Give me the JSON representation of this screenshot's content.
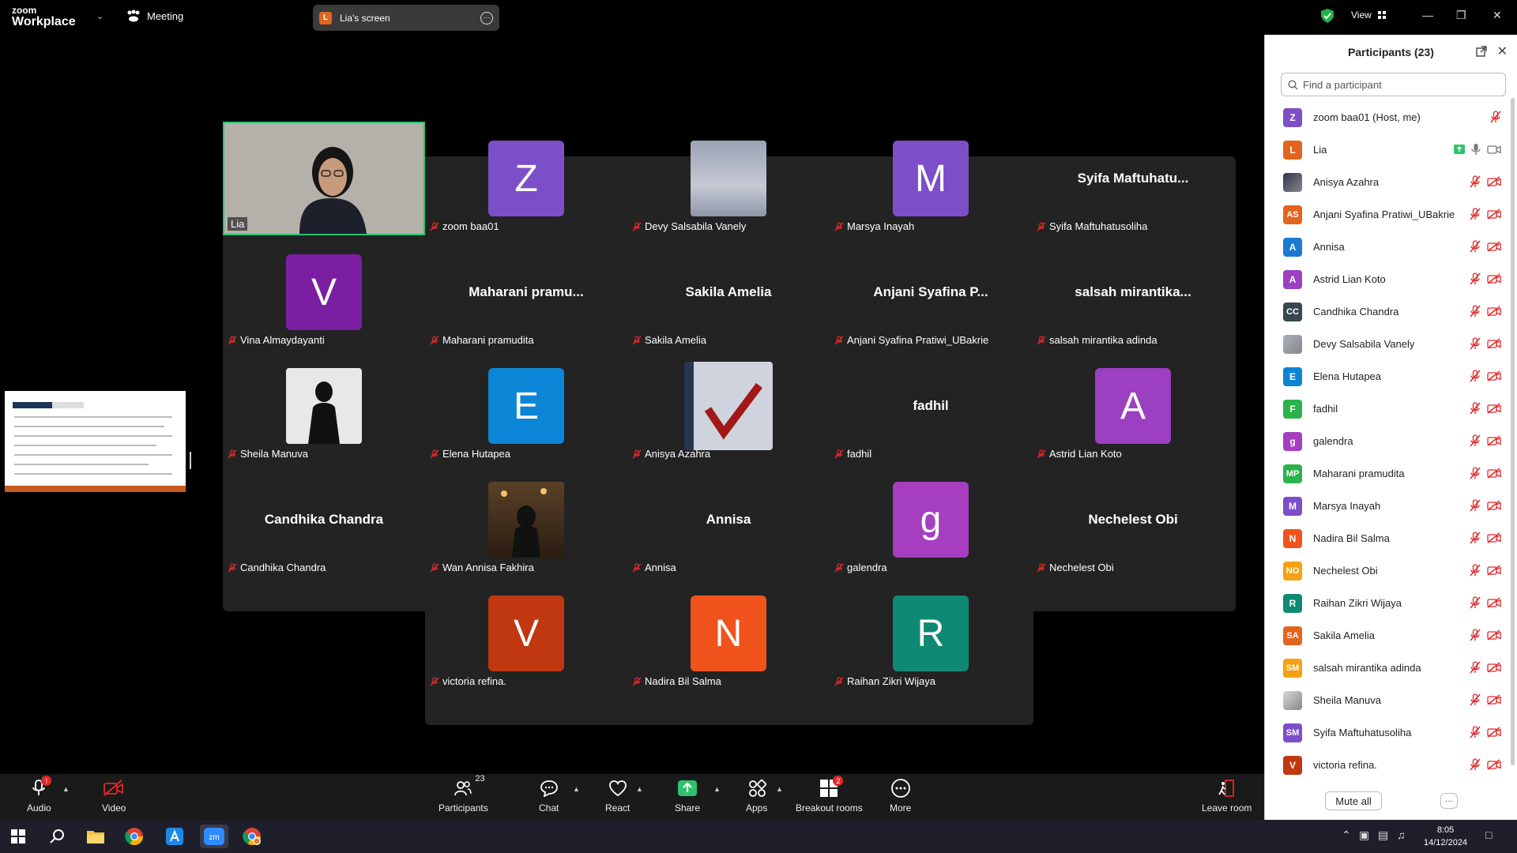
{
  "topbar": {
    "logo_line1": "zoom",
    "logo_line2": "Workplace",
    "meeting_label": "Meeting",
    "screen_share_avatar": "L",
    "screen_share_label": "Lia's screen",
    "view_label": "View"
  },
  "tiles": [
    {
      "name": "Lia",
      "type": "active"
    },
    {
      "name": "zoom baa01",
      "type": "avatar",
      "letter": "Z",
      "color": "#7c4fc8"
    },
    {
      "name": "Devy Salsabila Vanely",
      "type": "photo-sky"
    },
    {
      "name": "Marsya Inayah",
      "type": "avatar",
      "letter": "M",
      "color": "#7c4fc8"
    },
    {
      "name": "Syifa Maftuhatusoliha",
      "type": "text",
      "display": "Syifa  Maftuhatu..."
    },
    {
      "name": "Vina Almaydayanti",
      "type": "avatar",
      "letter": "V",
      "color": "#7b1fa2"
    },
    {
      "name": "Maharani pramudita",
      "type": "text",
      "display": "Maharani  pramu..."
    },
    {
      "name": "Sakila Amelia",
      "type": "text",
      "display": "Sakila Amelia"
    },
    {
      "name": "Anjani Syafina Pratiwi_UBakrie",
      "type": "text",
      "display": "Anjani  Syafina  P..."
    },
    {
      "name": "salsah mirantika adinda",
      "type": "text",
      "display": "salsah  mirantika..."
    },
    {
      "name": "Sheila Manuva",
      "type": "photo-person"
    },
    {
      "name": "Elena Hutapea",
      "type": "avatar",
      "letter": "E",
      "color": "#0b86d6"
    },
    {
      "name": "Anisya Azahra",
      "type": "photo-dark"
    },
    {
      "name": "fadhil",
      "type": "text",
      "display": "fadhil"
    },
    {
      "name": "Astrid Lian Koto",
      "type": "avatar",
      "letter": "A",
      "color": "#9c3fc0"
    },
    {
      "name": "Candhika Chandra",
      "type": "text",
      "display": "Candhika Chandra"
    },
    {
      "name": "Wan Annisa Fakhira",
      "type": "photo-cafe"
    },
    {
      "name": "Annisa",
      "type": "text",
      "display": "Annisa"
    },
    {
      "name": "galendra",
      "type": "avatar",
      "letter": "g",
      "color": "#a63ec0"
    },
    {
      "name": "Nechelest Obi",
      "type": "text",
      "display": "Nechelest Obi"
    },
    {
      "name": "victoria refina.",
      "type": "avatar",
      "letter": "V",
      "color": "#c0380f"
    },
    {
      "name": "Nadira Bil Salma",
      "type": "avatar",
      "letter": "N",
      "color": "#f0541c"
    },
    {
      "name": "Raihan Zikri Wijaya",
      "type": "avatar",
      "letter": "R",
      "color": "#0e8a74"
    }
  ],
  "panel": {
    "title": "Participants (23)",
    "search_placeholder": "Find a participant",
    "mute_all": "Mute all",
    "more": "···",
    "participants": [
      {
        "name": "zoom baa01 (Host, me)",
        "initials": "Z",
        "color": "#7c4fc8"
      },
      {
        "name": "Lia",
        "initials": "L",
        "color": "#e3641c"
      },
      {
        "name": "Anisya Azahra",
        "initials": "",
        "color": "#2a3550",
        "photo": true
      },
      {
        "name": "Anjani Syafina Pratiwi_UBakrie",
        "initials": "AS",
        "color": "#e3641c"
      },
      {
        "name": "Annisa",
        "initials": "A",
        "color": "#1b79d1"
      },
      {
        "name": "Astrid Lian Koto",
        "initials": "A",
        "color": "#9c3fc0"
      },
      {
        "name": "Candhika Chandra",
        "initials": "CC",
        "color": "#37474f"
      },
      {
        "name": "Devy Salsabila Vanely",
        "initials": "",
        "color": "#aab0bd",
        "photo": true
      },
      {
        "name": "Elena Hutapea",
        "initials": "E",
        "color": "#0b86d6"
      },
      {
        "name": "fadhil",
        "initials": "F",
        "color": "#2bb24c"
      },
      {
        "name": "galendra",
        "initials": "g",
        "color": "#a63ec0"
      },
      {
        "name": "Maharani pramudita",
        "initials": "MP",
        "color": "#2bb24c"
      },
      {
        "name": "Marsya Inayah",
        "initials": "M",
        "color": "#7c4fc8"
      },
      {
        "name": "Nadira Bil Salma",
        "initials": "N",
        "color": "#f0541c"
      },
      {
        "name": "Nechelest Obi",
        "initials": "NO",
        "color": "#f5a114"
      },
      {
        "name": "Raihan Zikri Wijaya",
        "initials": "R",
        "color": "#0e8a74"
      },
      {
        "name": "Sakila Amelia",
        "initials": "SA",
        "color": "#e3641c"
      },
      {
        "name": "salsah mirantika adinda",
        "initials": "SM",
        "color": "#f5a114"
      },
      {
        "name": "Sheila Manuva",
        "initials": "",
        "color": "#d8d8d8",
        "photo": true
      },
      {
        "name": "Syifa Maftuhatusoliha",
        "initials": "SM",
        "color": "#7c4fc8"
      },
      {
        "name": "victoria refina.",
        "initials": "V",
        "color": "#c0380f"
      }
    ]
  },
  "toolbar": {
    "audio": "Audio",
    "audio_badge": "!",
    "video": "Video",
    "participants": "Participants",
    "participants_count": "23",
    "chat": "Chat",
    "react": "React",
    "share": "Share",
    "apps": "Apps",
    "breakout": "Breakout rooms",
    "breakout_badge": "2",
    "more": "More",
    "leave": "Leave room"
  },
  "taskbar": {
    "time": "8:05",
    "date": "14/12/2024"
  },
  "colors": {
    "active_border": "#2ec26f",
    "mic_off": "#e02828",
    "share_green": "#2ec26f"
  }
}
